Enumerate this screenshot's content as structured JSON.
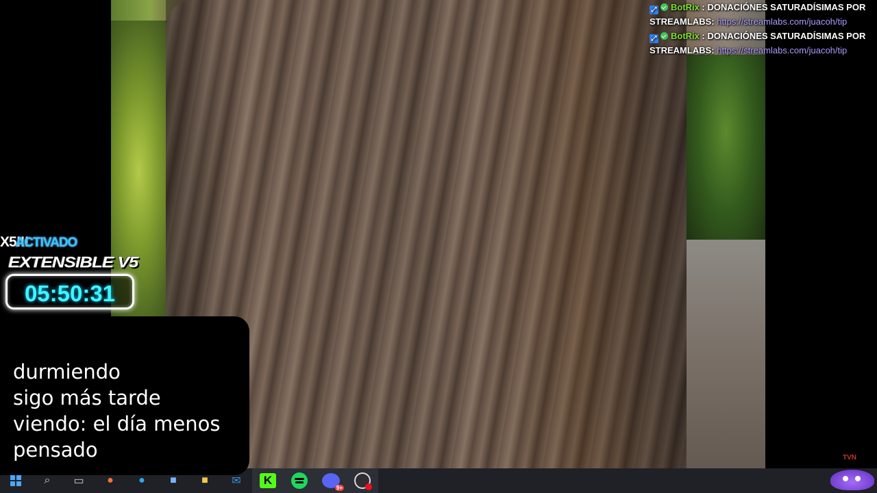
{
  "chat": {
    "messages": [
      {
        "user": "BotRix",
        "text": " : DONACIÓNES SATURADÍSIMAS POR STREAMLABS: ",
        "link": "https://streamlabs.com/juacoh/tip"
      },
      {
        "user": "BotRix",
        "text": " : DONACIÓNES SATURADÍSIMAS POR STREAMLABS: ",
        "link": "https://streamlabs.com/juacoh/tip"
      }
    ]
  },
  "timer": {
    "multiplier": "X5!!!",
    "status": "ACTIVADO",
    "title": "EXTENSIBLE V5",
    "value": "05:50:31"
  },
  "status_panel": {
    "lines": [
      "durmiendo",
      "sigo más tarde",
      "viendo: el día menos",
      "pensado"
    ]
  },
  "taskbar": {
    "icons": [
      "windows-start-icon",
      "search-icon",
      "task-view-icon",
      "firefox-icon",
      "edge-icon",
      "store-icon",
      "explorer-icon",
      "mail-icon",
      "kick-icon",
      "spotify-icon",
      "discord-icon",
      "obs-icon"
    ],
    "discord_badge": "9+",
    "kick_label": "K"
  },
  "colors": {
    "chat_user": "#7fe032",
    "chat_link": "#a99cff",
    "timer_value": "#3ff5ff",
    "timer_status": "#37c8ff",
    "kick": "#53fc18",
    "spotify": "#1ed760",
    "discord": "#5865f2"
  }
}
